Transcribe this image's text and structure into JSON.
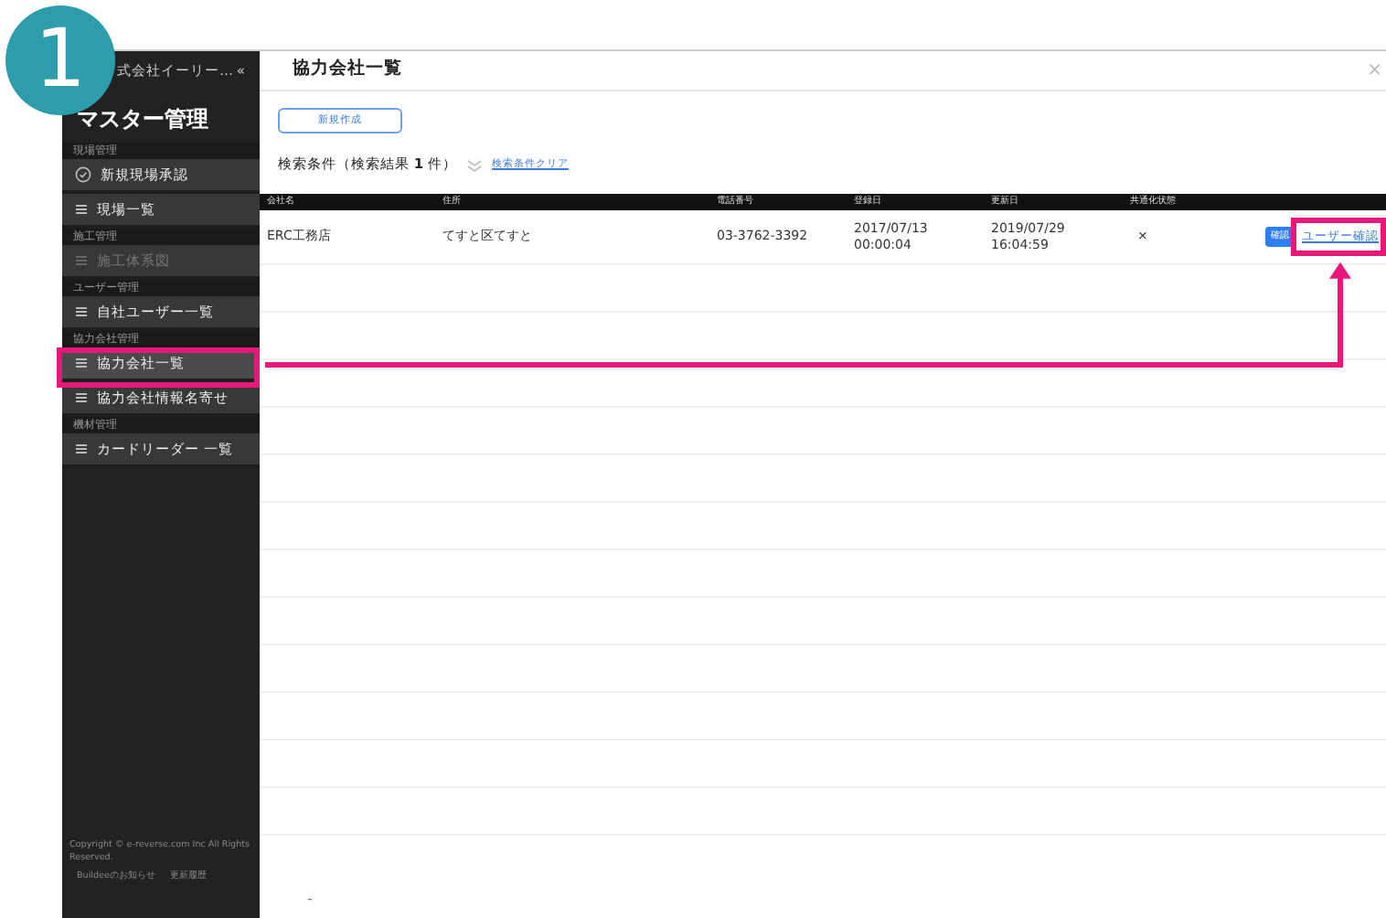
{
  "step_badge": "1",
  "sidebar": {
    "company": "式会社イーリー…",
    "collapse": "«",
    "title": "マスター管理",
    "sections": [
      {
        "header": "現場管理",
        "items": [
          {
            "label": "新規現場承認",
            "kind": "check",
            "selected": false,
            "disabled": false
          },
          {
            "label": "現場一覧",
            "kind": "list",
            "selected": false,
            "disabled": false
          }
        ]
      },
      {
        "header": "施工管理",
        "items": [
          {
            "label": "施工体系図",
            "kind": "list",
            "selected": false,
            "disabled": true
          }
        ]
      },
      {
        "header": "ユーザー管理",
        "items": [
          {
            "label": "自社ユーザー一覧",
            "kind": "list",
            "selected": false,
            "disabled": false
          }
        ]
      },
      {
        "header": "協力会社管理",
        "items": [
          {
            "label": "協力会社一覧",
            "kind": "list",
            "selected": true,
            "disabled": false
          },
          {
            "label": "協力会社情報名寄せ",
            "kind": "list",
            "selected": false,
            "disabled": false
          }
        ]
      },
      {
        "header": "機材管理",
        "items": [
          {
            "label": "カードリーダー 一覧",
            "kind": "list",
            "selected": false,
            "disabled": false
          }
        ]
      }
    ],
    "copyright": "Copyright © e-reverse.com Inc All Rights Reserved.",
    "footer_links": [
      "Buildeeのお知らせ",
      "更新履歴"
    ]
  },
  "main": {
    "title": "協力会社一覧",
    "close": "×",
    "new_button": "新規作成",
    "search_summary": "検索条件（検索結果 **1** 件）",
    "clear_link": "検索条件クリア",
    "table": {
      "columns": [
        "会社名",
        "住所",
        "電話番号",
        "登録日",
        "更新日",
        "共通化状態"
      ],
      "rows": [
        {
          "cells": [
            "ERC工務店",
            "てすと区てすと",
            "03-3762-3392",
            "2017/07/13\n00:00:04",
            "2019/07/29\n16:04:59",
            "×"
          ],
          "confirm": "確認",
          "user_link": "ユーザー確認"
        }
      ]
    },
    "bottom_mark": "-"
  }
}
